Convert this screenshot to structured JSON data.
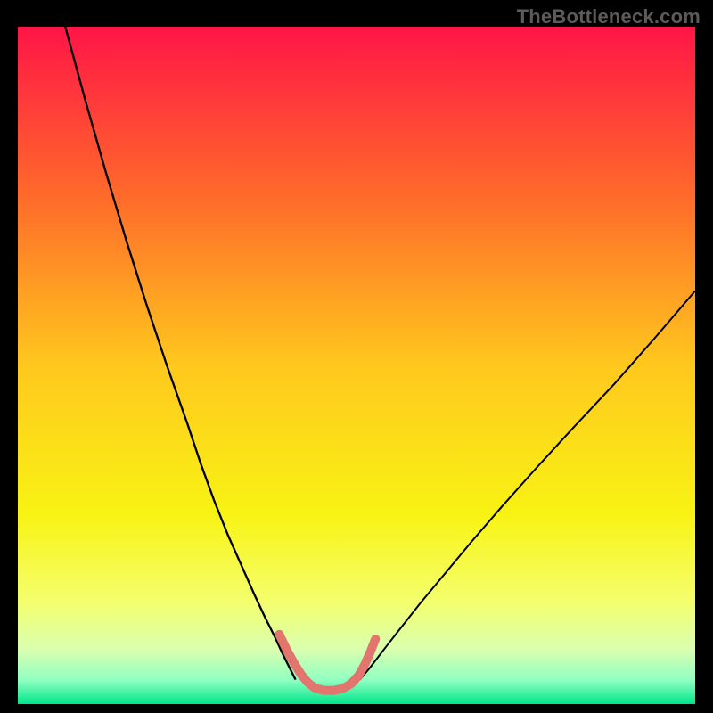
{
  "watermark": "TheBottleneck.com",
  "chart_data": {
    "type": "line",
    "title": "",
    "xlabel": "",
    "ylabel": "",
    "xlim": [
      0,
      100
    ],
    "ylim": [
      0,
      100
    ],
    "axes_visible": false,
    "grid": false,
    "background_gradient": {
      "stops": [
        {
          "offset": 0.0,
          "color": "#ff1547"
        },
        {
          "offset": 0.25,
          "color": "#ff6a2a"
        },
        {
          "offset": 0.5,
          "color": "#ffc81e"
        },
        {
          "offset": 0.72,
          "color": "#f8f314"
        },
        {
          "offset": 0.85,
          "color": "#f4ff6e"
        },
        {
          "offset": 0.92,
          "color": "#d9ffb0"
        },
        {
          "offset": 0.965,
          "color": "#8fffc1"
        },
        {
          "offset": 1.0,
          "color": "#00e58b"
        }
      ]
    },
    "series": [
      {
        "name": "bottleneck-curve-left",
        "stroke": "#000000",
        "stroke_width": 2.3,
        "x": [
          7,
          10,
          13,
          16,
          19,
          22,
          25,
          27,
          29,
          31,
          33,
          35,
          36.5,
          38,
          39.2,
          40.2,
          41
        ],
        "y": [
          100,
          89,
          78.5,
          68.5,
          59,
          50,
          41.5,
          35.5,
          30,
          25,
          20.5,
          16,
          12.8,
          9.8,
          7.2,
          5.2,
          3.6
        ]
      },
      {
        "name": "bottleneck-curve-right",
        "stroke": "#000000",
        "stroke_width": 2.0,
        "x": [
          50.5,
          52,
          54,
          56.5,
          59.5,
          63,
          67,
          71.5,
          76.5,
          82,
          88,
          94,
          100
        ],
        "y": [
          3.6,
          5.4,
          8.0,
          11.2,
          15.0,
          19.2,
          24.0,
          29.2,
          34.8,
          40.8,
          47.2,
          54.0,
          61.0
        ]
      },
      {
        "name": "trough-marker",
        "stroke": "#e2766f",
        "stroke_width": 10,
        "linecap": "round",
        "x": [
          38.6,
          39.7,
          40.8,
          41.8,
          42.8,
          43.8,
          45.2,
          46.6,
          48.0,
          49.2,
          50.3,
          51.2,
          52.0,
          52.8
        ],
        "y": [
          10.3,
          8.0,
          6.0,
          4.4,
          3.2,
          2.4,
          2.0,
          2.0,
          2.3,
          3.0,
          4.2,
          5.8,
          7.6,
          9.6
        ]
      }
    ]
  }
}
